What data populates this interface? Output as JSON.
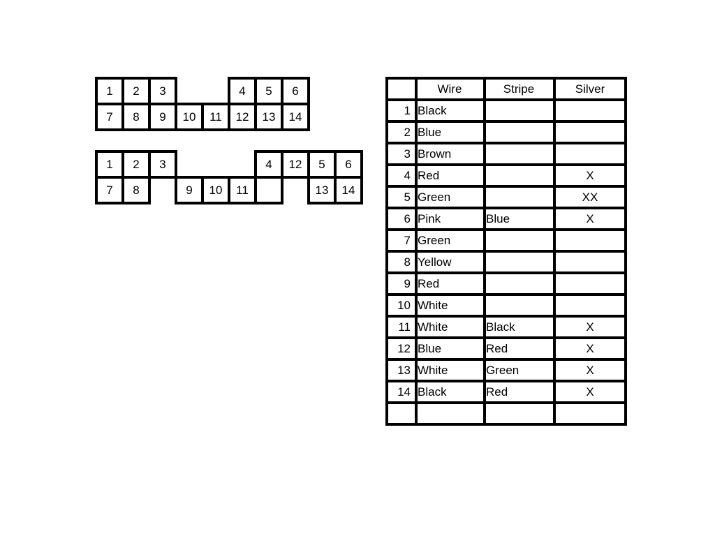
{
  "connector_a": [
    {
      "row": 0,
      "col": 0,
      "label": "1"
    },
    {
      "row": 0,
      "col": 1,
      "label": "2"
    },
    {
      "row": 0,
      "col": 2,
      "label": "3"
    },
    {
      "row": 0,
      "col": 5,
      "label": "4"
    },
    {
      "row": 0,
      "col": 6,
      "label": "5"
    },
    {
      "row": 0,
      "col": 7,
      "label": "6"
    },
    {
      "row": 1,
      "col": 0,
      "label": "7"
    },
    {
      "row": 1,
      "col": 1,
      "label": "8"
    },
    {
      "row": 1,
      "col": 2,
      "label": "9"
    },
    {
      "row": 1,
      "col": 3,
      "label": "10"
    },
    {
      "row": 1,
      "col": 4,
      "label": "11"
    },
    {
      "row": 1,
      "col": 5,
      "label": "12"
    },
    {
      "row": 1,
      "col": 6,
      "label": "13"
    },
    {
      "row": 1,
      "col": 7,
      "label": "14"
    }
  ],
  "connector_b": [
    {
      "row": 0,
      "col": 0,
      "label": "1"
    },
    {
      "row": 0,
      "col": 1,
      "label": "2"
    },
    {
      "row": 0,
      "col": 2,
      "label": "3"
    },
    {
      "row": 0,
      "col": 6,
      "label": "4"
    },
    {
      "row": 0,
      "col": 7,
      "label": "12"
    },
    {
      "row": 0,
      "col": 8,
      "label": "5"
    },
    {
      "row": 0,
      "col": 9,
      "label": "6"
    },
    {
      "row": 1,
      "col": 0,
      "label": "7"
    },
    {
      "row": 1,
      "col": 1,
      "label": "8"
    },
    {
      "row": 1,
      "col": 3,
      "label": "9"
    },
    {
      "row": 1,
      "col": 4,
      "label": "10"
    },
    {
      "row": 1,
      "col": 5,
      "label": "11"
    },
    {
      "row": 1,
      "col": 6,
      "label": ""
    },
    {
      "row": 1,
      "col": 8,
      "label": "13"
    },
    {
      "row": 1,
      "col": 9,
      "label": "14"
    }
  ],
  "table": {
    "headers": [
      "",
      "Wire",
      "Stripe",
      "Silver"
    ],
    "rows": [
      [
        "1",
        "Black",
        "",
        ""
      ],
      [
        "2",
        "Blue",
        "",
        ""
      ],
      [
        "3",
        "Brown",
        "",
        ""
      ],
      [
        "4",
        "Red",
        "",
        "X"
      ],
      [
        "5",
        "Green",
        "",
        "XX"
      ],
      [
        "6",
        "Pink",
        "Blue",
        "X"
      ],
      [
        "7",
        "Green",
        "",
        ""
      ],
      [
        "8",
        "Yellow",
        "",
        ""
      ],
      [
        "9",
        "Red",
        "",
        ""
      ],
      [
        "10",
        "White",
        "",
        ""
      ],
      [
        "11",
        "White",
        "Black",
        "X"
      ],
      [
        "12",
        "Blue",
        "Red",
        "X"
      ],
      [
        "13",
        "White",
        "Green",
        "X"
      ],
      [
        "14",
        "Black",
        "Red",
        "X"
      ],
      [
        "",
        "",
        "",
        ""
      ]
    ]
  }
}
